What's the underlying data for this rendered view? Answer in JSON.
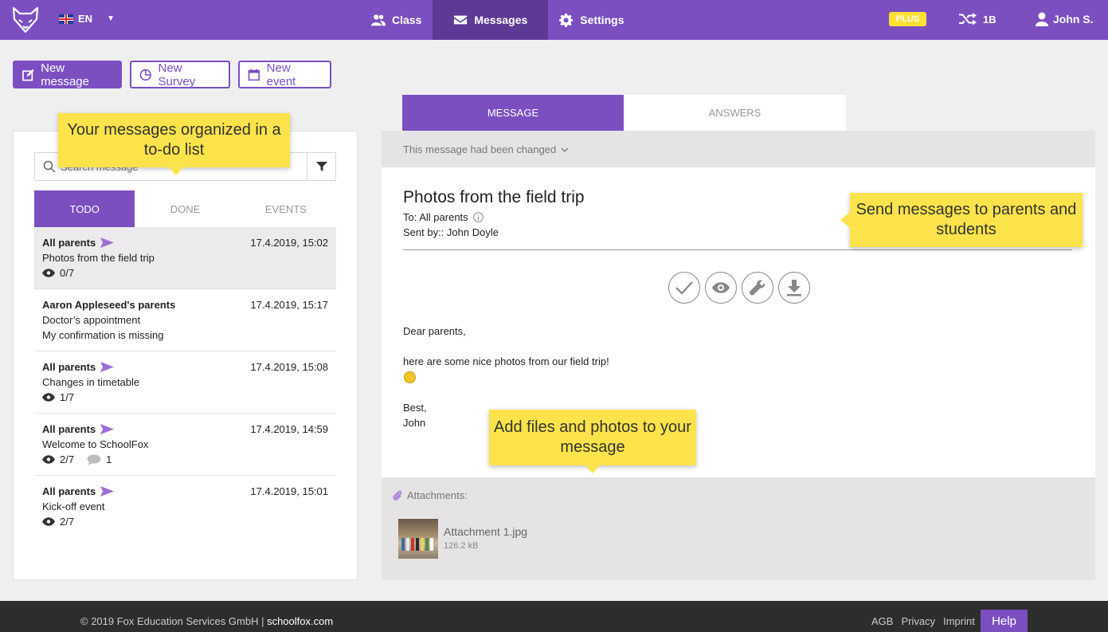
{
  "brand": {
    "accent": "#7b4fc0",
    "accent_dark": "#5c3a96",
    "tooltip": "#fde34b",
    "logo_icon": "fox-logo-icon"
  },
  "header": {
    "language": "EN",
    "nav": [
      {
        "label": "Class",
        "icon": "users-icon"
      },
      {
        "label": "Messages",
        "icon": "envelope-icon",
        "active": true
      },
      {
        "label": "Settings",
        "icon": "gear-icon"
      }
    ],
    "plus_badge": "PLUS",
    "class_name": "1B",
    "user_name": "John S."
  },
  "actions": {
    "new_message": "New message",
    "new_survey": "New Survey",
    "new_event": "New event"
  },
  "search": {
    "placeholder": "Search message"
  },
  "list_tabs": [
    "TODO",
    "DONE",
    "EVENTS"
  ],
  "messages": [
    {
      "recipient": "All parents",
      "date": "17.4.2019, 15:02",
      "subject": "Photos from the field trip",
      "views": "0/7"
    },
    {
      "recipient": "Aaron Appleseed's parents",
      "date": "17.4.2019, 15:17",
      "subject": "Doctor’s appointment",
      "note": "My confirmation is missing"
    },
    {
      "recipient": "All parents",
      "date": "17.4.2019, 15:08",
      "subject": "Changes in timetable",
      "views": "1/7"
    },
    {
      "recipient": "All parents",
      "date": "17.4.2019, 14:59",
      "subject": "Welcome to SchoolFox",
      "views": "2/7",
      "comments": "1"
    },
    {
      "recipient": "All parents",
      "date": "17.4.2019, 15:01",
      "subject": "Kick-off event",
      "views": "2/7"
    }
  ],
  "detail_tabs": [
    "MESSAGE",
    "ANSWERS"
  ],
  "detail": {
    "changed_notice": "This message had been changed",
    "subject": "Photos from the field trip",
    "to": "To: All parents",
    "sent_by": "Sent by:: John Doyle",
    "greeting": "Dear parents,",
    "body": "here are some nice photos from our field trip!",
    "closing": "Best,",
    "signature": "John",
    "attachments_label": "Attachments:",
    "attachment_name": "Attachment 1.jpg",
    "attachment_size": "126.2 kB"
  },
  "tooltips": {
    "todo": "Your messages organized in a to-do list",
    "send": "Send messages to parents and students",
    "files": "Add files and photos to your message"
  },
  "footer": {
    "copyright": "© 2019 Fox Education Services GmbH | ",
    "site": "schoolfox.com",
    "links": [
      "AGB",
      "Privacy",
      "Imprint"
    ],
    "help": "Help"
  }
}
